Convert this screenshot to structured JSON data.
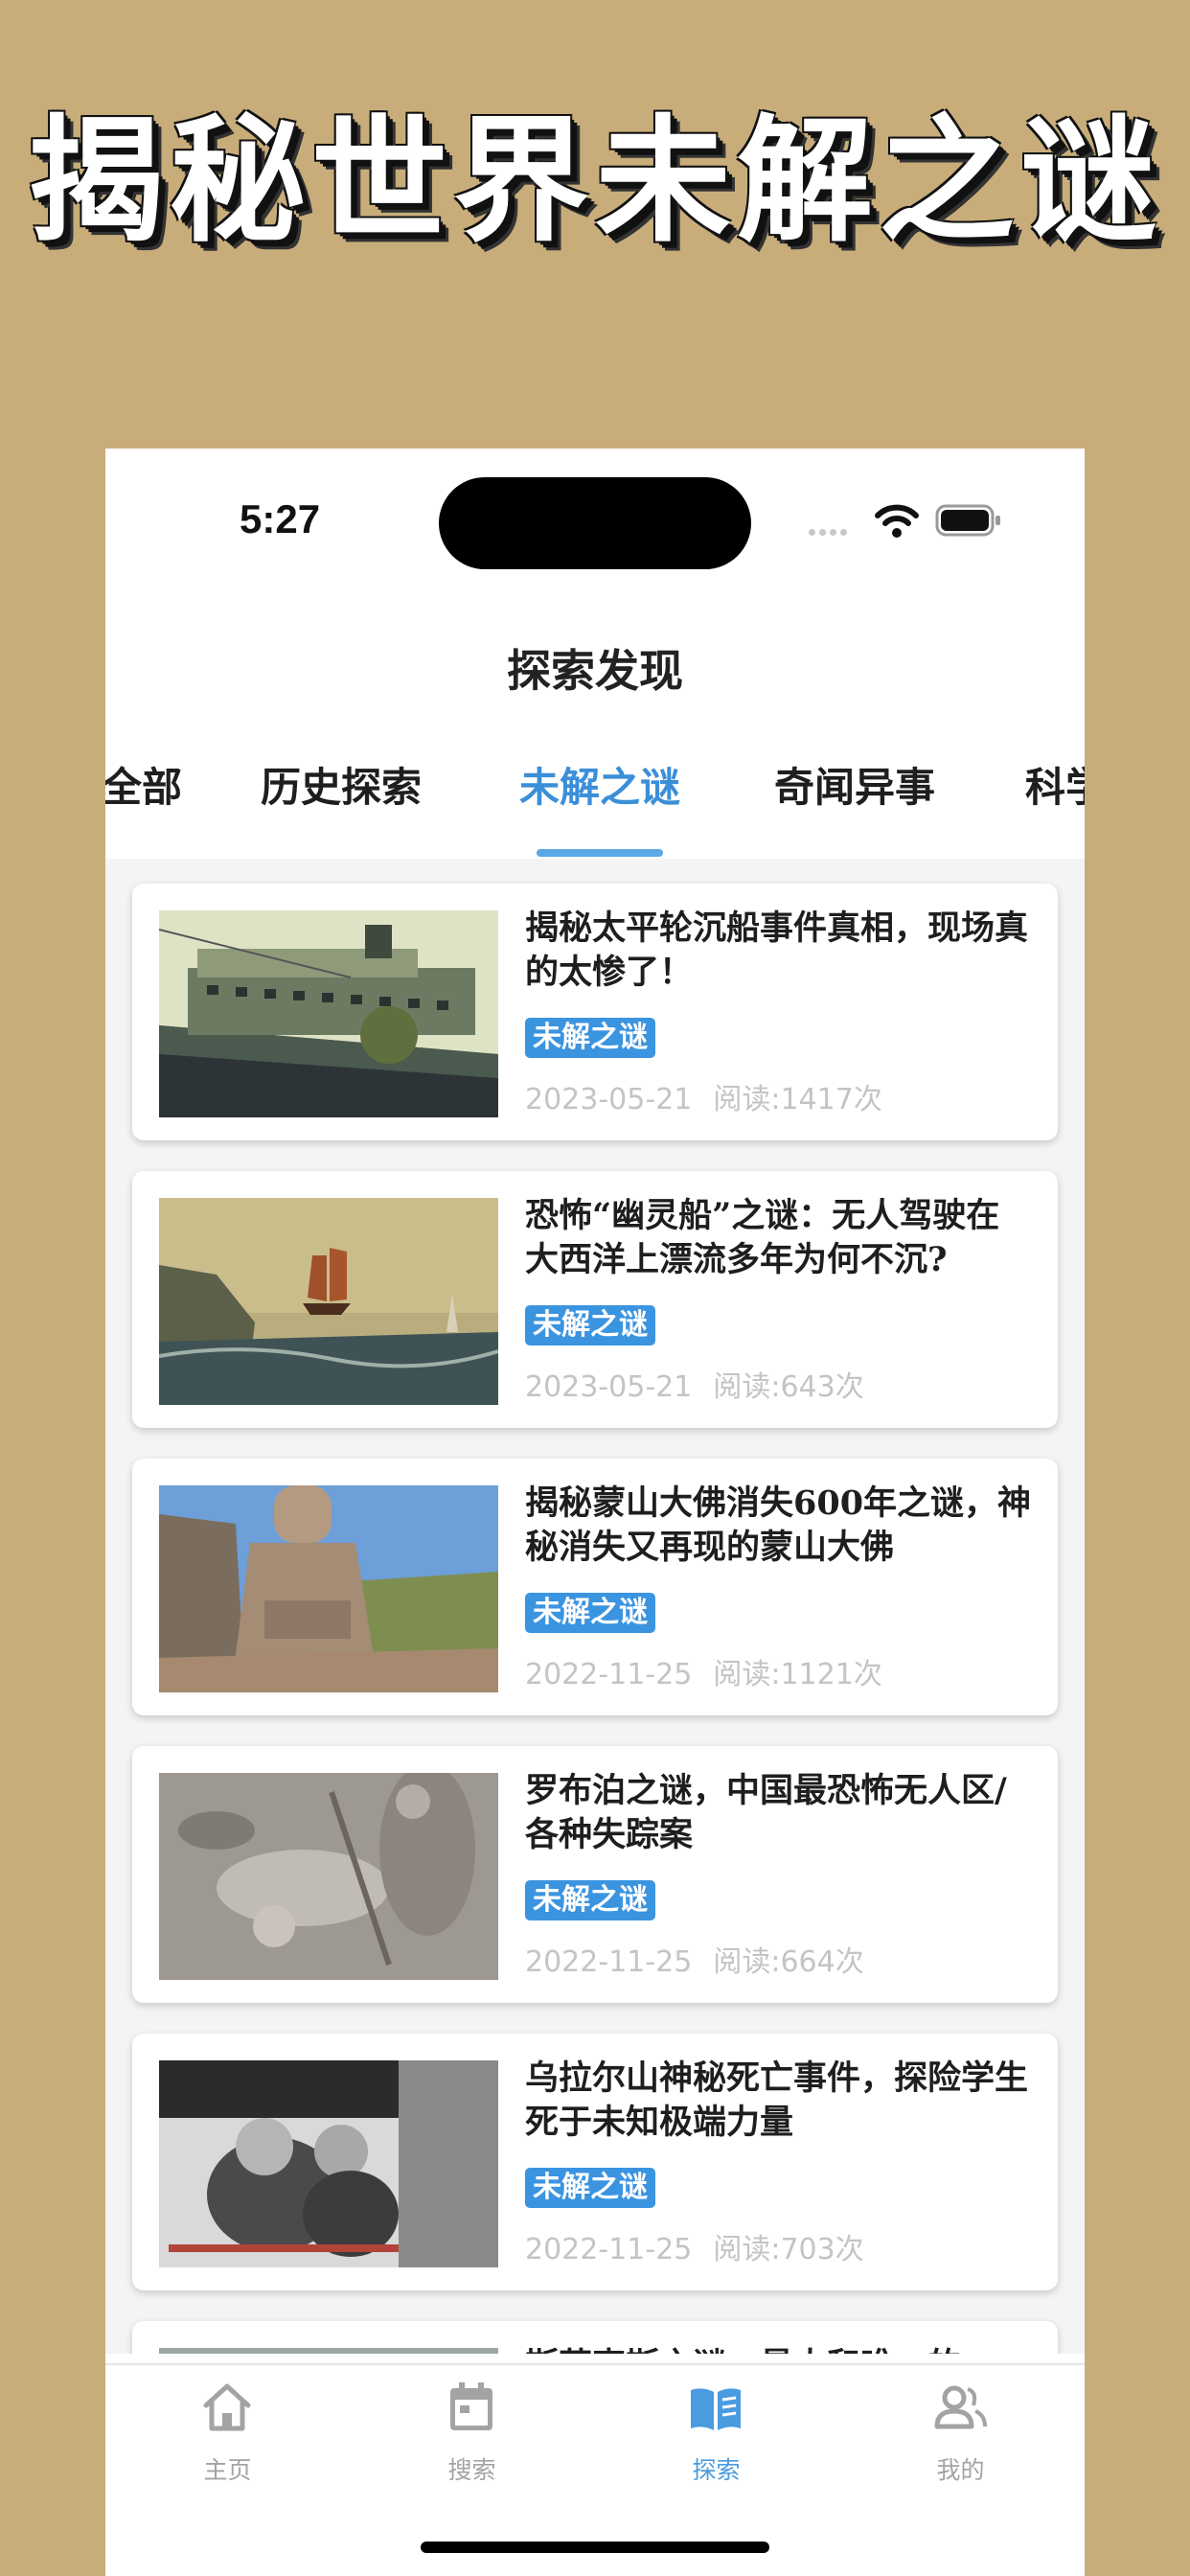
{
  "promo": {
    "title": "揭秘世界未解之谜"
  },
  "status_bar": {
    "time": "5:27"
  },
  "header": {
    "title": "探索发现"
  },
  "tabs": [
    {
      "label": "全部"
    },
    {
      "label": "历史探索"
    },
    {
      "label": "未解之谜",
      "active": true
    },
    {
      "label": "奇闻异事"
    },
    {
      "label": "科学"
    }
  ],
  "articles": [
    {
      "title": "揭秘太平轮沉船事件真相，现场真的太惨了！",
      "tag": "未解之谜",
      "date": "2023-05-21",
      "reads": "阅读:1417次",
      "image": "ship-photo"
    },
    {
      "title": "恐怖“幽灵船”之谜：无人驾驶在大西洋上漂流多年为何不沉?",
      "tag": "未解之谜",
      "date": "2023-05-21",
      "reads": "阅读:643次",
      "image": "ghost-ship-painting"
    },
    {
      "title": "揭秘蒙山大佛消失600年之谜，神秘消失又再现的蒙山大佛",
      "tag": "未解之谜",
      "date": "2022-11-25",
      "reads": "阅读:1121次",
      "image": "buddha-statue-photo"
    },
    {
      "title": "罗布泊之谜，中国最恐怖无人区/各种失踪案",
      "tag": "未解之谜",
      "date": "2022-11-25",
      "reads": "阅读:664次",
      "image": "desert-remains-photo"
    },
    {
      "title": "乌拉尔山神秘死亡事件，探险学生死于未知极端力量",
      "tag": "未解之谜",
      "date": "2022-11-25",
      "reads": "阅读:703次",
      "image": "snow-expedition-photo"
    },
    {
      "title": "斯芬克斯之谜，最大和唯一的",
      "tag": "",
      "date": "",
      "reads": "",
      "image": "partial-photo"
    }
  ],
  "tabbar": [
    {
      "label": "主页",
      "icon": "home-icon"
    },
    {
      "label": "搜索",
      "icon": "calendar-icon"
    },
    {
      "label": "探索",
      "icon": "book-icon",
      "active": true
    },
    {
      "label": "我的",
      "icon": "users-icon"
    }
  ],
  "colors": {
    "background": "#c8ad7b",
    "accent": "#3b8fd8",
    "tag": "#3b94e0"
  }
}
